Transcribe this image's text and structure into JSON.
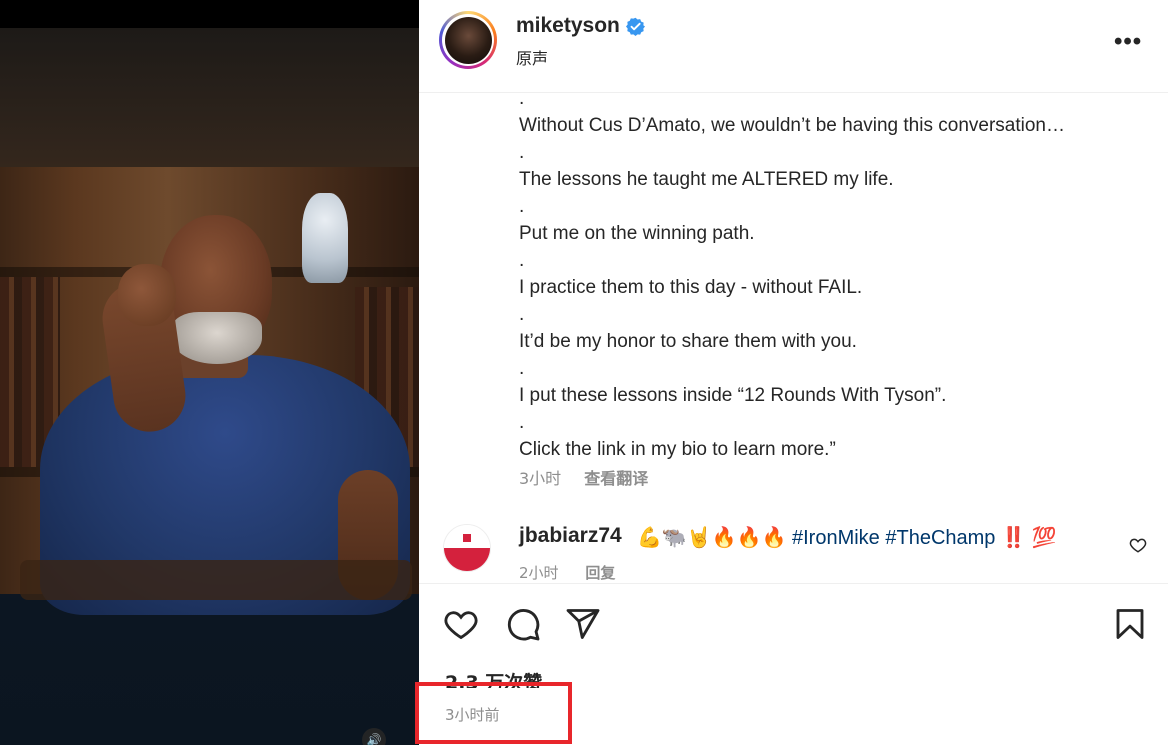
{
  "post": {
    "username": "miketyson",
    "verified": true,
    "audio_label": "原声",
    "more_icon": "more-horizontal-icon",
    "caption_lines": [
      ".",
      "Without Cus D’Amato, we wouldn’t be having this conversation…",
      ".",
      "The lessons he taught me ALTERED my life.",
      ".",
      "Put me on the winning path.",
      ".",
      "I practice them to this day - without FAIL.",
      ".",
      "It’d be my honor to share them with you.",
      ".",
      "I put these lessons inside “12 Rounds With Tyson”.",
      ".",
      "Click the link in my bio to learn more.”"
    ],
    "caption_time": "3小时",
    "translate_label": "查看翻译"
  },
  "comment": {
    "username": "jbabiarz74",
    "text_emoji": "💪🐃🤘🔥🔥🔥",
    "hashtags": [
      "#IronMike",
      "#TheChamp"
    ],
    "text_suffix": "‼️ 💯",
    "time": "2小时",
    "reply_label": "回复",
    "like_icon": "heart-outline-icon"
  },
  "actions": {
    "like_icon": "heart-outline-icon",
    "comment_icon": "speech-bubble-icon",
    "share_icon": "paper-plane-icon",
    "save_icon": "bookmark-icon"
  },
  "stats": {
    "likes": "2.3 万次赞",
    "post_time": "3小时前"
  },
  "video": {
    "mute_icon": "speaker-icon"
  },
  "colors": {
    "verified_blue": "#3897f0",
    "hashtag": "#00376b",
    "secondary_text": "#8e8e8e",
    "highlight_red": "#e8262b"
  }
}
